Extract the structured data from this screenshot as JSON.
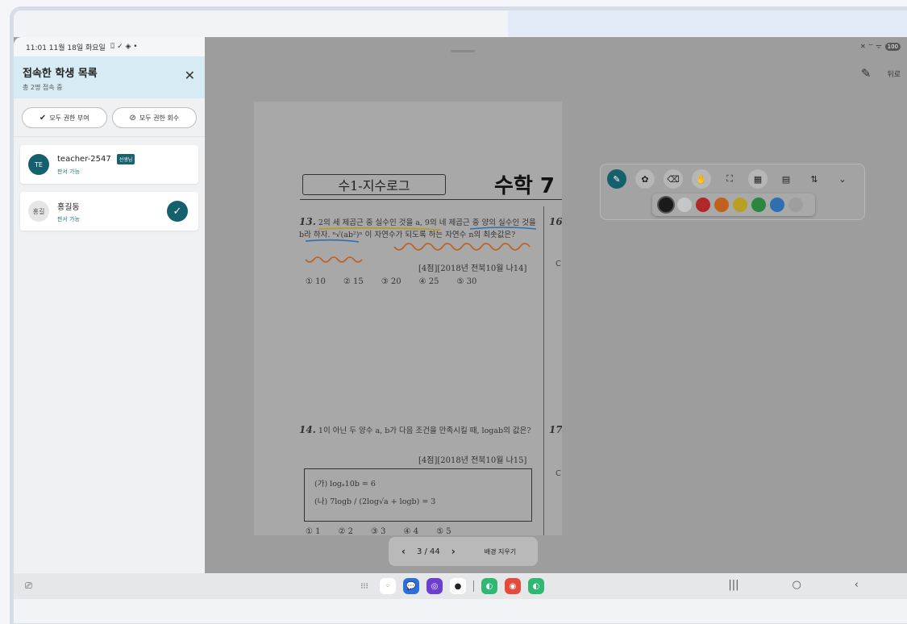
{
  "panel": {
    "status_time": "11:01  11월 18일 화요일",
    "status_icons": "⌼ ✓ ◈ •",
    "title": "접속한 학생 목록",
    "subtitle": "총 2명 접속 중",
    "close_icon": "✕",
    "grant_all": "모두 권한 부여",
    "revoke_all": "모두 권한 회수",
    "users": [
      {
        "avatar": "TE",
        "name": "teacher-2547",
        "badge": "선생님",
        "perm": "판서 가능"
      },
      {
        "avatar": "홍길",
        "name": "홍길동",
        "perm": "판서 가능"
      }
    ]
  },
  "status_right": {
    "icons": "✕ ⌔ ᯤ",
    "battery": "100"
  },
  "topbar": {
    "back_label": "뒤로"
  },
  "document": {
    "box_title": "수1-지수로그",
    "big_title": "수학 7",
    "q13": {
      "num": "13.",
      "text": "2의 세 제곱근 중 실수인 것을 a, 9의 네 제곱근 중 양의 실수인 것을 b라 하자. ⁿ√(ab²)ⁿ 이 자연수가 되도록 하는 자연수 n의 최솟값은?",
      "meta": "[4점][2018년 전북10월 나14]",
      "choices": [
        "① 10",
        "② 15",
        "③ 20",
        "④ 25",
        "⑤ 30"
      ]
    },
    "q14": {
      "num": "14.",
      "text": "1이 아닌 두 양수 a, b가 다음 조건을 만족시킬 때, logab의 값은?",
      "meta": "[4점][2018년 전북10월 나15]",
      "cond_a": "(가)  logₐ10b = 6",
      "cond_b": "(나)  7logb / (2log√a + logb) = 3",
      "choices": [
        "① 1",
        "② 2",
        "③ 3",
        "④ 4",
        "⑤ 5"
      ]
    },
    "side_16": "16",
    "side_17": "17"
  },
  "toolbar": {
    "tools": [
      "pen-icon",
      "palette-icon",
      "eraser-icon",
      "hand-icon",
      "fullscreen-icon",
      "qr-icon",
      "pdf-icon",
      "sort-icon",
      "chevron-down-icon"
    ],
    "tool_glyphs": [
      "✎",
      "✿",
      "⌫",
      "✋",
      "⛶",
      "▦",
      "▤",
      "⇅",
      "⌄"
    ],
    "colors": [
      "#1a1a1a",
      "#c6c6c6",
      "#b0282a",
      "#c0611c",
      "#b9a023",
      "#2a8740",
      "#2f6fb0",
      "#9e9e9e"
    ]
  },
  "pager": {
    "page": "3 / 44",
    "prev": "‹",
    "next": "›",
    "clear_label": "배경 지우기"
  },
  "dock": {
    "apps": [
      "⁝⁝⁝",
      "◦",
      "💬",
      "◎",
      "●",
      "◐",
      "◉",
      "◐"
    ]
  }
}
